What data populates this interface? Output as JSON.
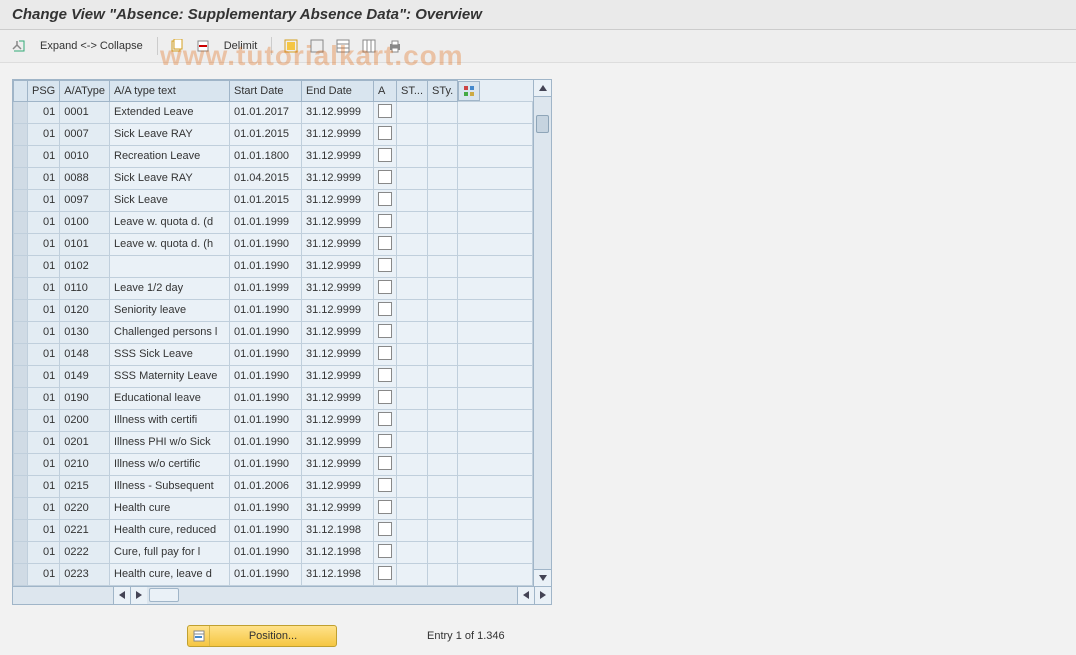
{
  "title": "Change View \"Absence: Supplementary Absence Data\": Overview",
  "watermark": "www.tutorialkart.com",
  "toolbar": {
    "expand_collapse": "Expand <-> Collapse",
    "delimit": "Delimit"
  },
  "grid": {
    "headers": {
      "psg": "PSG",
      "aatype": "A/AType",
      "text": "A/A type text",
      "start": "Start Date",
      "end": "End Date",
      "a": "A",
      "st": "ST...",
      "sty": "STy."
    },
    "rows": [
      {
        "psg": "01",
        "aatype": "0001",
        "text": "Extended Leave",
        "start": "01.01.2017",
        "end": "31.12.9999"
      },
      {
        "psg": "01",
        "aatype": "0007",
        "text": "Sick Leave RAY",
        "start": "01.01.2015",
        "end": "31.12.9999"
      },
      {
        "psg": "01",
        "aatype": "0010",
        "text": "Recreation Leave",
        "start": "01.01.1800",
        "end": "31.12.9999"
      },
      {
        "psg": "01",
        "aatype": "0088",
        "text": "Sick Leave RAY",
        "start": "01.04.2015",
        "end": "31.12.9999"
      },
      {
        "psg": "01",
        "aatype": "0097",
        "text": "Sick Leave",
        "start": "01.01.2015",
        "end": "31.12.9999"
      },
      {
        "psg": "01",
        "aatype": "0100",
        "text": "Leave w. quota d. (d",
        "start": "01.01.1999",
        "end": "31.12.9999"
      },
      {
        "psg": "01",
        "aatype": "0101",
        "text": "Leave w. quota d. (h",
        "start": "01.01.1990",
        "end": "31.12.9999"
      },
      {
        "psg": "01",
        "aatype": "0102",
        "text": "",
        "start": "01.01.1990",
        "end": "31.12.9999"
      },
      {
        "psg": "01",
        "aatype": "0110",
        "text": "Leave 1/2 day",
        "start": "01.01.1999",
        "end": "31.12.9999"
      },
      {
        "psg": "01",
        "aatype": "0120",
        "text": "Seniority leave",
        "start": "01.01.1990",
        "end": "31.12.9999"
      },
      {
        "psg": "01",
        "aatype": "0130",
        "text": "Challenged persons l",
        "start": "01.01.1990",
        "end": "31.12.9999"
      },
      {
        "psg": "01",
        "aatype": "0148",
        "text": "SSS Sick Leave",
        "start": "01.01.1990",
        "end": "31.12.9999"
      },
      {
        "psg": "01",
        "aatype": "0149",
        "text": "SSS Maternity Leave",
        "start": "01.01.1990",
        "end": "31.12.9999"
      },
      {
        "psg": "01",
        "aatype": "0190",
        "text": "Educational leave",
        "start": "01.01.1990",
        "end": "31.12.9999"
      },
      {
        "psg": "01",
        "aatype": "0200",
        "text": "Illness with certifi",
        "start": "01.01.1990",
        "end": "31.12.9999"
      },
      {
        "psg": "01",
        "aatype": "0201",
        "text": "Illness PHI w/o Sick",
        "start": "01.01.1990",
        "end": "31.12.9999"
      },
      {
        "psg": "01",
        "aatype": "0210",
        "text": "Illness w/o certific",
        "start": "01.01.1990",
        "end": "31.12.9999"
      },
      {
        "psg": "01",
        "aatype": "0215",
        "text": "Illness - Subsequent",
        "start": "01.01.2006",
        "end": "31.12.9999"
      },
      {
        "psg": "01",
        "aatype": "0220",
        "text": "Health cure",
        "start": "01.01.1990",
        "end": "31.12.9999"
      },
      {
        "psg": "01",
        "aatype": "0221",
        "text": "Health cure, reduced",
        "start": "01.01.1990",
        "end": "31.12.1998"
      },
      {
        "psg": "01",
        "aatype": "0222",
        "text": "Cure, full pay for l",
        "start": "01.01.1990",
        "end": "31.12.1998"
      },
      {
        "psg": "01",
        "aatype": "0223",
        "text": "Health cure, leave d",
        "start": "01.01.1990",
        "end": "31.12.1998"
      }
    ]
  },
  "footer": {
    "position_label": "Position...",
    "entry_info": "Entry 1 of 1.346"
  }
}
